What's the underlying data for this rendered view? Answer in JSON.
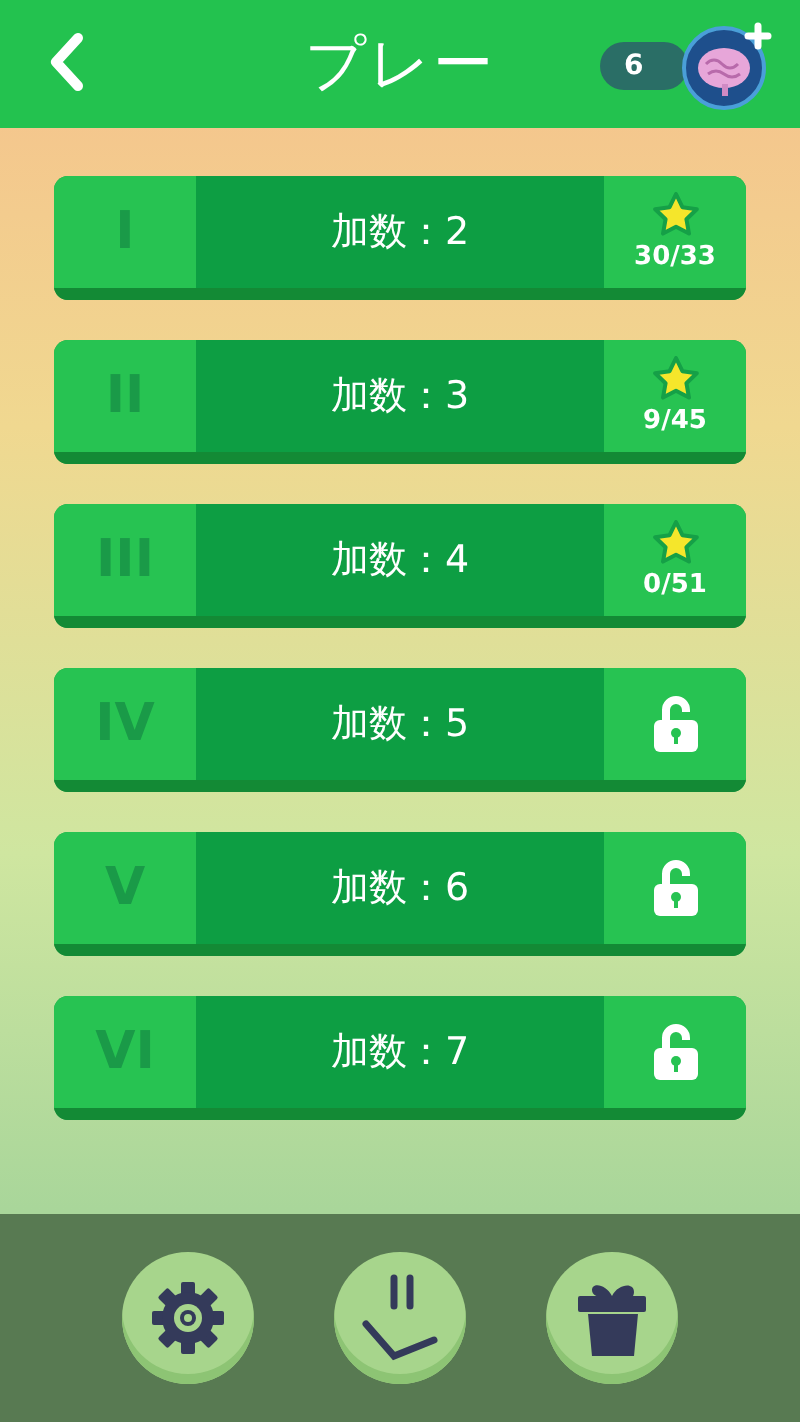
{
  "header": {
    "title": "プレー",
    "brain_count": "6"
  },
  "levels": [
    {
      "numeral": "I",
      "label": "加数：2",
      "kind": "progress",
      "progress": "30/33"
    },
    {
      "numeral": "II",
      "label": "加数：3",
      "kind": "progress",
      "progress": "9/45"
    },
    {
      "numeral": "III",
      "label": "加数：4",
      "kind": "progress",
      "progress": "0/51"
    },
    {
      "numeral": "IV",
      "label": "加数：5",
      "kind": "locked"
    },
    {
      "numeral": "V",
      "label": "加数：6",
      "kind": "locked"
    },
    {
      "numeral": "VI",
      "label": "加数：7",
      "kind": "locked"
    }
  ],
  "footer": {
    "buttons": [
      {
        "kind": "settings"
      },
      {
        "kind": "smile"
      },
      {
        "kind": "gift"
      }
    ]
  }
}
